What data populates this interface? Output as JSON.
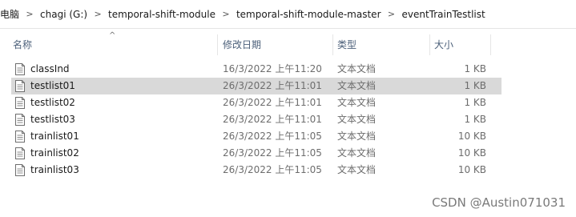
{
  "breadcrumb": {
    "items": [
      "电脑",
      "chagi (G:)",
      "temporal-shift-module",
      "temporal-shift-module-master",
      "eventTrainTestlist"
    ],
    "separator": ">"
  },
  "columns": {
    "name": "名称",
    "date": "修改日期",
    "type": "类型",
    "size": "大小",
    "sort_indicator": "^"
  },
  "files": [
    {
      "name": "classInd",
      "date": "16/3/2022 上午11:20",
      "type": "文本文档",
      "size": "1 KB",
      "selected": false
    },
    {
      "name": "testlist01",
      "date": "26/3/2022 上午11:01",
      "type": "文本文档",
      "size": "1 KB",
      "selected": true
    },
    {
      "name": "testlist02",
      "date": "26/3/2022 上午11:01",
      "type": "文本文档",
      "size": "1 KB",
      "selected": false
    },
    {
      "name": "testlist03",
      "date": "26/3/2022 上午11:01",
      "type": "文本文档",
      "size": "1 KB",
      "selected": false
    },
    {
      "name": "trainlist01",
      "date": "26/3/2022 上午11:05",
      "type": "文本文档",
      "size": "10 KB",
      "selected": false
    },
    {
      "name": "trainlist02",
      "date": "26/3/2022 上午11:05",
      "type": "文本文档",
      "size": "10 KB",
      "selected": false
    },
    {
      "name": "trainlist03",
      "date": "26/3/2022 上午11:05",
      "type": "文本文档",
      "size": "10 KB",
      "selected": false
    }
  ],
  "file_icon": "text-document-icon",
  "watermark": "CSDN @Austin071031",
  "colors": {
    "selected_row": "#d9d9d9",
    "header_text": "#4c607a",
    "meta_text": "#6d6d6d"
  }
}
